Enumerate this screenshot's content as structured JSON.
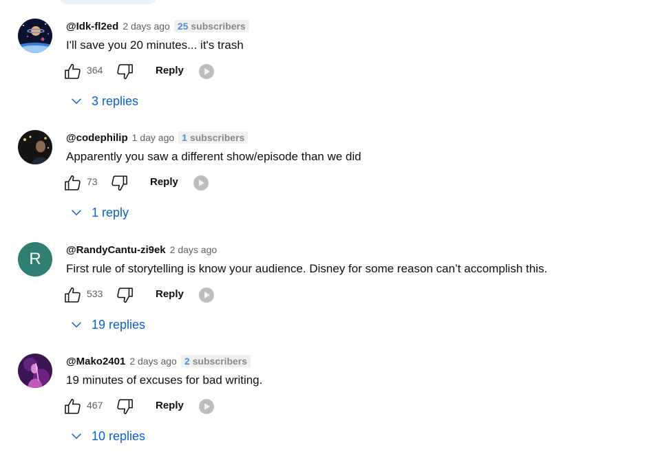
{
  "comments": [
    {
      "author": "@Idk-fl2ed",
      "time": "2 days ago",
      "badge": {
        "count": "25",
        "label": "subscribers"
      },
      "text": "I'll save you 20 minutes... it's trash",
      "likes": "364",
      "reply_label": "Reply",
      "replies_label": "3 replies",
      "avatar": {
        "type": "image",
        "icon": "space-planet-avatar"
      }
    },
    {
      "author": "@codephilip",
      "time": "1 day ago",
      "badge": {
        "count": "1",
        "label": "subscribers"
      },
      "text": "Apparently you saw a different show/episode than we did",
      "likes": "73",
      "reply_label": "Reply",
      "replies_label": "1 reply",
      "avatar": {
        "type": "image",
        "icon": "person-photo-avatar"
      }
    },
    {
      "author": "@RandyCantu-zi9ek",
      "time": "2 days ago",
      "badge": null,
      "text": "First rule of storytelling is know your audience. Disney for some reason can’t accomplish this.",
      "likes": "533",
      "reply_label": "Reply",
      "replies_label": "19 replies",
      "avatar": {
        "type": "letter",
        "letter": "R",
        "color": "#2f7f73"
      }
    },
    {
      "author": "@Mako2401",
      "time": "2 days ago",
      "badge": {
        "count": "2",
        "label": "subscribers"
      },
      "text": "19 minutes of excuses for bad writing.",
      "likes": "467",
      "reply_label": "Reply",
      "replies_label": "10 replies",
      "avatar": {
        "type": "image",
        "icon": "neon-figure-avatar"
      }
    }
  ],
  "colors": {
    "link_blue": "#065fd4",
    "badge_count_blue": "#4d90d8",
    "secondary_text": "#606060"
  }
}
